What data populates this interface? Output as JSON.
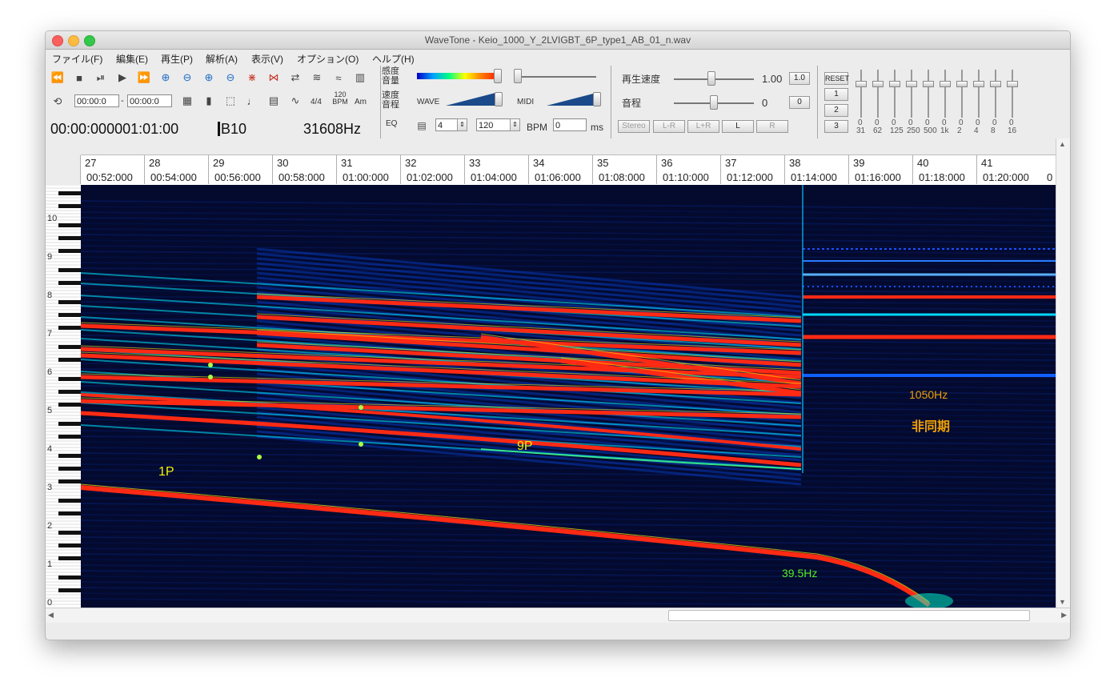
{
  "window": {
    "title": "WaveTone - Keio_1000_Y_2LVIGBT_6P_type1_AB_01_n.wav"
  },
  "menu": [
    "ファイル(F)",
    "編集(E)",
    "再生(P)",
    "解析(A)",
    "表示(V)",
    "オプション(O)",
    "ヘルプ(H)"
  ],
  "toolbar": {
    "loop_start": "00:00:0",
    "loop_end": "00:00:0",
    "time_sig": "4/4",
    "bpm_icon_top": "120",
    "bpm_icon_bottom": "BPM",
    "chord_icon": "Am",
    "position_readout": "00:00:000001:01:00",
    "note_readout": "B10",
    "freq_readout": "31608Hz",
    "sens_label_1": "感度",
    "sens_label_2": "音量",
    "speed_label_1": "速度",
    "speed_label_2": "音程",
    "eq_label": "EQ",
    "wave_label": "WAVE",
    "midi_label": "MIDI",
    "beat_value": "4",
    "bpm_value": "120",
    "bpm_label": "BPM",
    "ms_value": "0",
    "ms_label": "ms",
    "speed_caption": "再生速度",
    "speed_value": "1.00",
    "speed_reset": "1.0",
    "pitch_caption": "音程",
    "pitch_value": "0",
    "pitch_reset": "0",
    "channel_buttons": [
      "Stereo",
      "L-R",
      "L+R",
      "L",
      "R"
    ],
    "reset_label": "RESET",
    "preset_buttons": [
      "1",
      "2",
      "3"
    ],
    "eq_bands": [
      "31",
      "62",
      "125",
      "250",
      "500",
      "1k",
      "2",
      "4",
      "8",
      "16"
    ],
    "eq_values": [
      "0",
      "0",
      "0",
      "0",
      "0",
      "0",
      "0",
      "0",
      "0",
      "0"
    ]
  },
  "timeline": {
    "measures": [
      "27",
      "28",
      "29",
      "30",
      "31",
      "32",
      "33",
      "34",
      "35",
      "36",
      "37",
      "38",
      "39",
      "40",
      "41"
    ],
    "times": [
      "00:52:000",
      "00:54:000",
      "00:56:000",
      "00:58:000",
      "01:00:000",
      "01:02:000",
      "01:04:000",
      "01:06:000",
      "01:08:000",
      "01:10:000",
      "01:12:000",
      "01:14:000",
      "01:16:000",
      "01:18:000",
      "01:20:000",
      "0"
    ]
  },
  "keyboard": {
    "octaves": [
      "10",
      "9",
      "8",
      "7",
      "6",
      "5",
      "4",
      "3",
      "2",
      "1",
      "0"
    ]
  },
  "annotations": {
    "label_1p": "1P",
    "label_9p": "9P",
    "label_1050": "1050Hz",
    "label_async": "非同期",
    "label_395": "39.5Hz"
  },
  "colors": {
    "low": "#0a2cff",
    "mid": "#00e8ff",
    "peak": "#ff2a14",
    "label_yellow": "#f2f200",
    "label_orange": "#f0a000",
    "label_green": "#55ee22"
  }
}
